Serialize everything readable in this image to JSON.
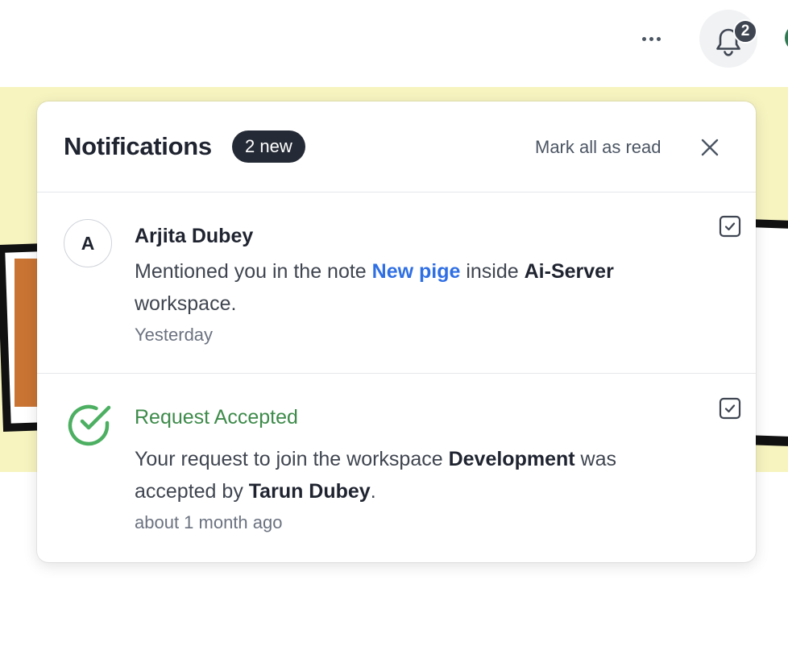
{
  "topbar": {
    "bell_count": "2",
    "more_icon": "more-horizontal-icon",
    "bell_icon": "bell-icon"
  },
  "panel": {
    "title": "Notifications",
    "new_badge": "2 new",
    "mark_all_label": "Mark all as read",
    "close_icon": "close-icon"
  },
  "notifications": [
    {
      "avatar_letter": "A",
      "title": "Arjita Dubey",
      "text_1": "Mentioned you in the note ",
      "link": "New pige",
      "text_2": " inside ",
      "workspace": "Ai-Server",
      "text_3": " workspace.",
      "time": "Yesterday"
    },
    {
      "icon": "check-circle-icon",
      "title": "Request Accepted",
      "text_1": "Your request to join the workspace ",
      "workspace": "Development",
      "text_2": " was accepted by ",
      "user": "Tarun Dubey",
      "text_3": ".",
      "time": "about 1 month ago"
    }
  ],
  "colors": {
    "accent_link": "#2f6fe4",
    "success": "#3d8b4a",
    "badge_bg": "#252b36",
    "cover_bg": "#f7f4c0"
  }
}
